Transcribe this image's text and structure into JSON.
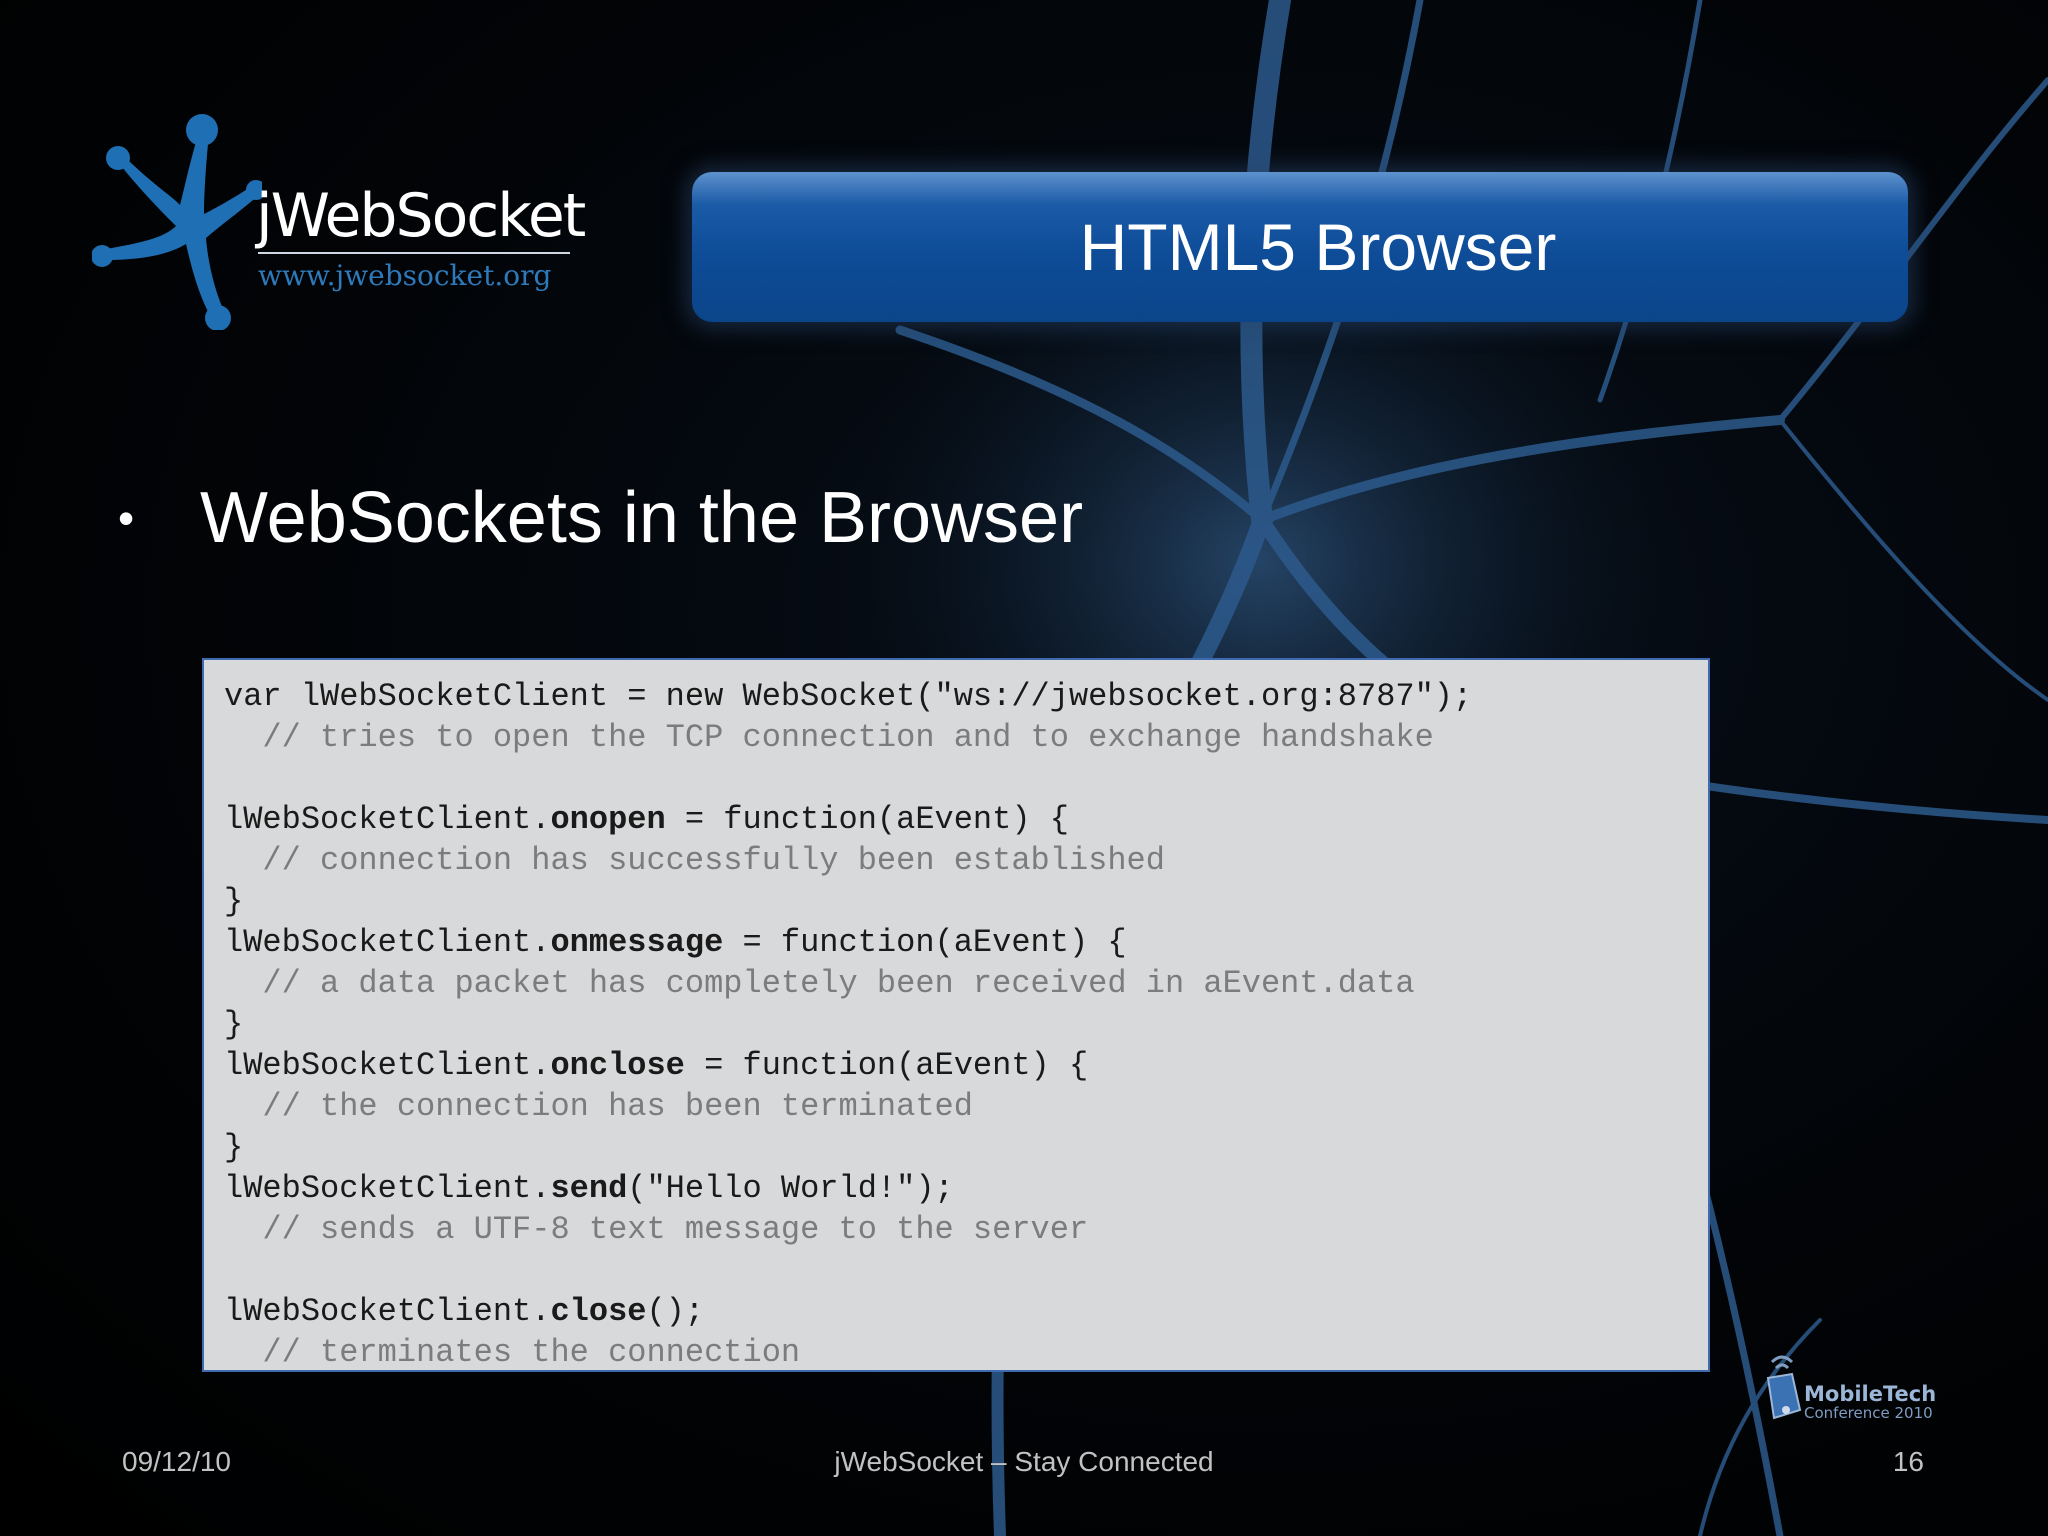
{
  "logo": {
    "name": "jWebSocket",
    "url": "www.jwebsocket.org",
    "brand_color": "#1e6fb3"
  },
  "title": "HTML5 Browser",
  "bullet": {
    "symbol": "•",
    "text": "WebSockets in the Browser"
  },
  "code": {
    "line1": "var lWebSocketClient = new WebSocket(\"ws://jwebsocket.org:8787\");",
    "line2": "  // tries to open the TCP connection and to exchange handshake",
    "line3": "",
    "line4_pre": "lWebSocketClient.",
    "line4_bold": "onopen",
    "line4_post": " = function(aEvent) {",
    "line5": "  // connection has successfully been established",
    "line6": "}",
    "line7_pre": "lWebSocketClient.",
    "line7_bold": "onmessage",
    "line7_post": " = function(aEvent) {",
    "line8": "  // a data packet has completely been received in aEvent.data",
    "line9": "}",
    "line10_pre": "lWebSocketClient.",
    "line10_bold": "onclose",
    "line10_post": " = function(aEvent) {",
    "line11": "  // the connection has been terminated",
    "line12": "}",
    "line13_pre": "lWebSocketClient.",
    "line13_bold": "send",
    "line13_post": "(\"Hello World!\");",
    "line14": "  // sends a UTF-8 text message to the server",
    "line15": "",
    "line16_pre": "lWebSocketClient.",
    "line16_bold": "close",
    "line16_post": "();",
    "line17": "  // terminates the connection"
  },
  "footer": {
    "date": "09/12/10",
    "center": "jWebSocket – Stay Connected",
    "page": "16"
  },
  "sponsor_logo": {
    "name": "MobileTech",
    "sub": "Conference 2010"
  }
}
